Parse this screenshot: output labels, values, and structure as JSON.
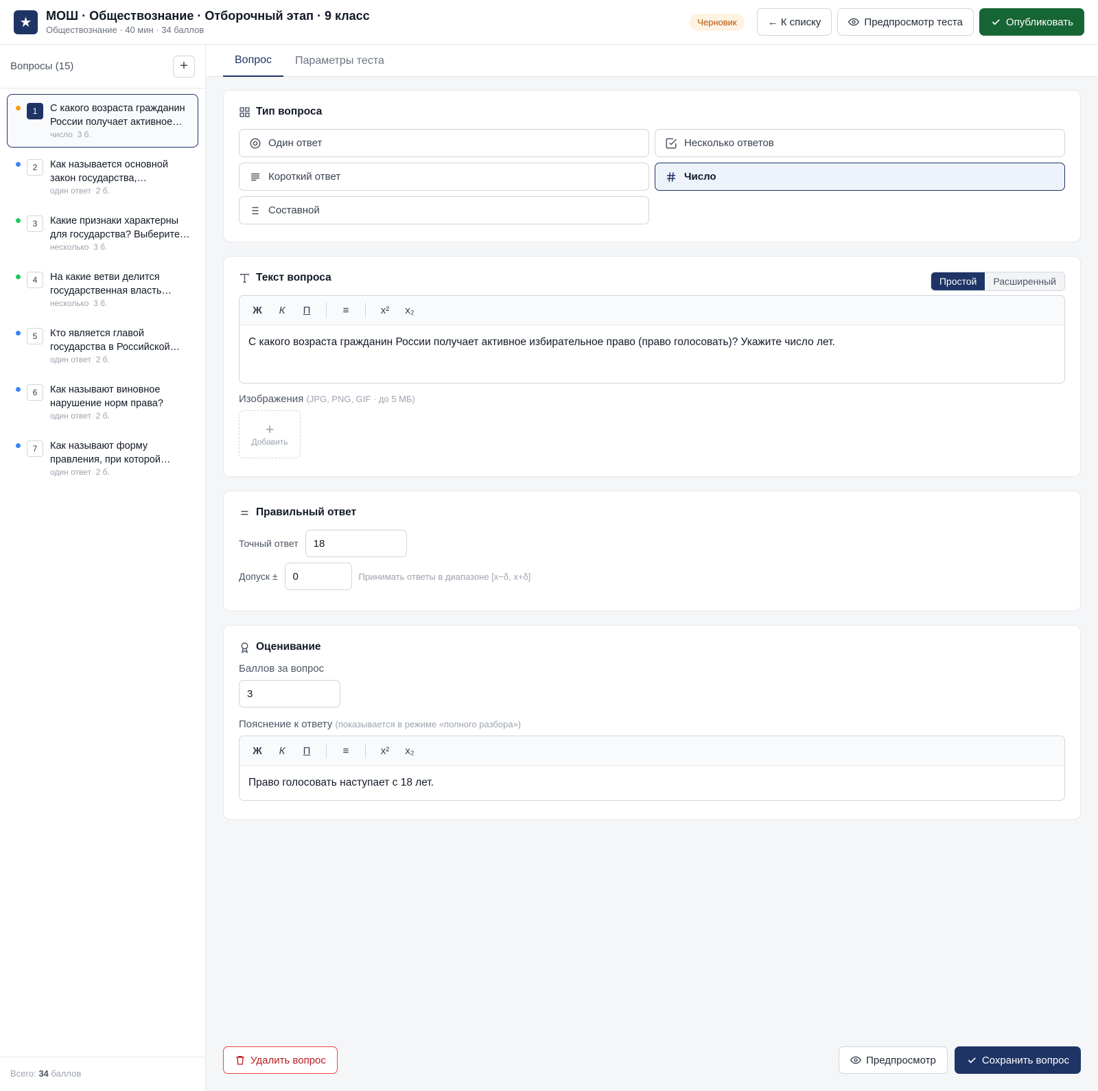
{
  "header": {
    "logo_glyph": "★",
    "title": "МОШ · Обществознание · Отборочный этап · 9 класс",
    "subtitle": "Обществознание · 40 мин · 34 баллов",
    "status_badge": "Черновик",
    "back_label": "← К списку",
    "preview_label": "Предпросмотр теста",
    "publish_label": "Опубликовать"
  },
  "sidebar": {
    "title": "Вопросы (15)",
    "add_label": "+",
    "items": [
      {
        "num": "1",
        "text": "С какого возраста гражданин России получает активное…",
        "type": "число",
        "points": "3 б.",
        "dot": "#f59e0b"
      },
      {
        "num": "2",
        "text": "Как называется основной закон государства,…",
        "type": "один ответ",
        "points": "2 б.",
        "dot": "#3b82f6"
      },
      {
        "num": "3",
        "text": "Какие признаки характерны для государства? Выберите…",
        "type": "несколько",
        "points": "3 б.",
        "dot": "#22c55e"
      },
      {
        "num": "4",
        "text": "На какие ветви делится государственная власть…",
        "type": "несколько",
        "points": "3 б.",
        "dot": "#22c55e"
      },
      {
        "num": "5",
        "text": "Кто является главой государства в Российской…",
        "type": "один ответ",
        "points": "2 б.",
        "dot": "#3b82f6"
      },
      {
        "num": "6",
        "text": "Как называют виновное нарушение норм права?",
        "type": "один ответ",
        "points": "2 б.",
        "dot": "#3b82f6"
      },
      {
        "num": "7",
        "text": "Как называют форму правления, при которой…",
        "type": "один ответ",
        "points": "2 б.",
        "dot": "#3b82f6"
      }
    ],
    "footer_prefix": "Всего: ",
    "footer_value": "34",
    "footer_suffix": " баллов"
  },
  "tabs": [
    {
      "label": "Вопрос"
    },
    {
      "label": "Параметры теста"
    }
  ],
  "question_type": {
    "title": "Тип вопроса",
    "options": [
      {
        "label": "Один ответ"
      },
      {
        "label": "Несколько ответов"
      },
      {
        "label": "Короткий ответ"
      },
      {
        "label": "Число"
      },
      {
        "label": "Составной"
      }
    ]
  },
  "question_text": {
    "title": "Текст вопроса",
    "mode_simple": "Простой",
    "mode_advanced": "Расширенный",
    "toolbar": {
      "bold": "Ж",
      "italic": "К",
      "underline": "П",
      "list": "≡",
      "sup": "x²",
      "sub": "x₂"
    },
    "content": "С какого возраста гражданин России получает активное избирательное право (право голосовать)? Укажите число лет.",
    "images_label": "Изображения",
    "images_hint": "(JPG, PNG, GIF · до 5 МБ)",
    "add_image_plus": "+",
    "add_image_label": "Добавить"
  },
  "correct_answer": {
    "title": "Правильный ответ",
    "exact_label": "Точный ответ",
    "exact_value": "18",
    "tolerance_label": "Допуск ±",
    "tolerance_value": "0",
    "tolerance_hint": "Принимать ответы в диапазоне [x−δ, x+δ]"
  },
  "grading": {
    "title": "Оценивание",
    "points_label": "Баллов за вопрос",
    "points_value": "3",
    "explanation_label": "Пояснение к ответу",
    "explanation_hint": "(показывается в режиме «полного разбора»)",
    "explanation_content": "Право голосовать наступает с 18 лет."
  },
  "footer": {
    "delete_label": "Удалить вопрос",
    "preview_label": "Предпросмотр",
    "save_label": "Сохранить вопрос"
  },
  "colors": {
    "brand": "#1e3466",
    "publish": "#166534",
    "danger": "#ef4444"
  }
}
